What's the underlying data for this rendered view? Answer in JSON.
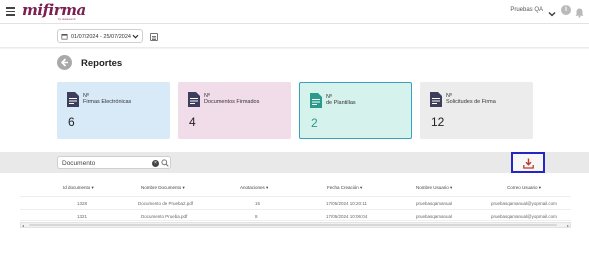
{
  "header": {
    "logo_text": "mifirma",
    "logo_subtext": "by alaskasoft",
    "user_name": "Pruebas QA",
    "help_label": "i"
  },
  "date_filter": {
    "range": "01/07/2024 - 25/07/2024"
  },
  "page": {
    "title": "Reportes"
  },
  "cards": [
    {
      "line1": "Nº",
      "line2": "Firmas Electrónicas",
      "value": "6",
      "color": "#d8e9f8"
    },
    {
      "line1": "Nº",
      "line2": "Documentos Firmados",
      "value": "4",
      "color": "#f1dce9"
    },
    {
      "line1": "Nº",
      "line2": "de Plantillas",
      "value": "2",
      "color": "#d6f2ec"
    },
    {
      "line1": "Nº",
      "line2": "Solicitudes de Firma",
      "value": "12",
      "color": "#ececec"
    }
  ],
  "search": {
    "value": "Documento",
    "clear_label": "×"
  },
  "table": {
    "headers": [
      "Id documento",
      "Nombre Documento",
      "Anotaciones",
      "Fecha Creación",
      "Nombre Usuario",
      "Correo Usuario"
    ],
    "rows": [
      [
        "1328",
        "Documento de Prueba2.pdf",
        "15",
        "17/05/2024 10:20:11",
        "pruebasqamanual",
        "pruebasqamanual@yopmail.com"
      ],
      [
        "1321",
        "Documento Prueba.pdf",
        "8",
        "17/05/2024 10:06:04",
        "pruebasqamanual",
        "pruebasqamanual@yopmail.com"
      ]
    ]
  },
  "colors": {
    "brand": "#7a1f4f",
    "selected_card_border": "#3aa0bf",
    "download_border": "#2525c8",
    "icon_color": "#3d3d5c"
  }
}
